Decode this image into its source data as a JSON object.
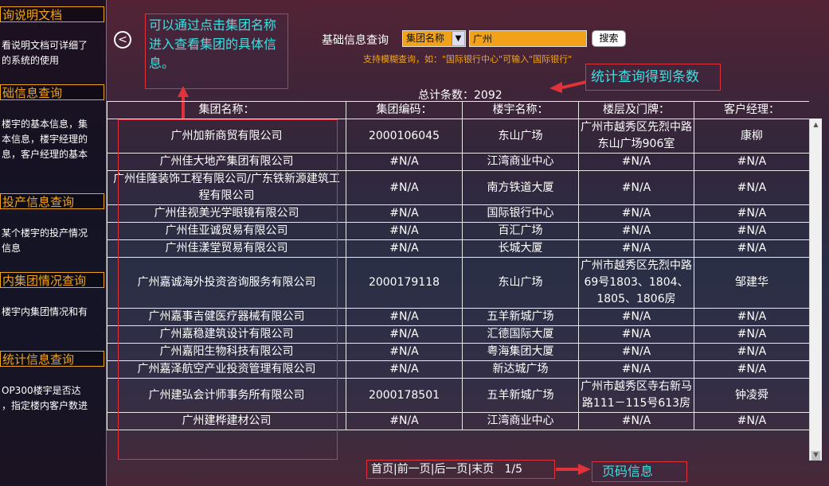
{
  "sidebar": {
    "sections": [
      {
        "title": "询说明文档",
        "text": "看说明文档可详细了\n的系统的使用"
      },
      {
        "title": "础信息查询",
        "text": "楼宇的基本信息，集\n本信息，楼宇经理的\n息，客户经理的基本"
      },
      {
        "title": "投产信息查询",
        "text": "某个楼宇的投产情况\n信息"
      },
      {
        "title": "内集团情况查询",
        "text": "楼宇内集团情况和有"
      },
      {
        "title": "统计信息查询",
        "text": "OP300楼宇是否达\n，指定楼内客户数进"
      }
    ]
  },
  "search": {
    "label": "基础信息查询",
    "select_value": "集团名称",
    "input_value": "广州",
    "button": "搜索",
    "hint": "支持模糊查询，如：\"国际银行中心\"可输入\"国际银行\""
  },
  "total": "总计条数：2092",
  "annotations": {
    "top": "可以通过点击集团名称进入查看集团的具体信息。",
    "count": "统计查询得到条数",
    "pager": "页码信息"
  },
  "table": {
    "headers": [
      "集团名称：",
      "集团编码：",
      "楼宇名称：",
      "楼层及门牌：",
      "客户经理："
    ],
    "rows": [
      [
        "广州加新商贸有限公司",
        "2000106045",
        "东山广场",
        "广州市越秀区先烈中路东山广场906室",
        "康柳"
      ],
      [
        "广州佳大地产集团有限公司",
        "#N/A",
        "江湾商业中心",
        "#N/A",
        "#N/A"
      ],
      [
        "广州佳隆装饰工程有限公司/广东铁新源建筑工程有限公司",
        "#N/A",
        "南方铁道大厦",
        "#N/A",
        "#N/A"
      ],
      [
        "广州佳视美光学眼镜有限公司",
        "#N/A",
        "国际银行中心",
        "#N/A",
        "#N/A"
      ],
      [
        "广州佳亚诚贸易有限公司",
        "#N/A",
        "百汇广场",
        "#N/A",
        "#N/A"
      ],
      [
        "广州佳漾堂贸易有限公司",
        "#N/A",
        "长城大厦",
        "#N/A",
        "#N/A"
      ],
      [
        "广州嘉诚海外投资咨询服务有限公司",
        "2000179118",
        "东山广场",
        "广州市越秀区先烈中路69号1803、1804、1805、1806房",
        "邹建华"
      ],
      [
        "广州嘉事吉健医疗器械有限公司",
        "#N/A",
        "五羊新城广场",
        "#N/A",
        "#N/A"
      ],
      [
        "广州嘉稳建筑设计有限公司",
        "#N/A",
        "汇德国际大厦",
        "#N/A",
        "#N/A"
      ],
      [
        "广州嘉阳生物科技有限公司",
        "#N/A",
        "粤海集团大厦",
        "#N/A",
        "#N/A"
      ],
      [
        "广州嘉泽航空产业投资管理有限公司",
        "#N/A",
        "新达城广场",
        "#N/A",
        "#N/A"
      ],
      [
        "广州建弘会计师事务所有限公司",
        "2000178501",
        "五羊新城广场",
        "广州市越秀区寺右新马路111－115号613房",
        "钟凌舜"
      ],
      [
        "广州建桦建材公司",
        "#N/A",
        "江湾商业中心",
        "#N/A",
        "#N/A"
      ]
    ]
  },
  "pager": {
    "first": "首页",
    "prev": "前一页",
    "next": "后一页",
    "last": "末页",
    "page": "1/5"
  }
}
